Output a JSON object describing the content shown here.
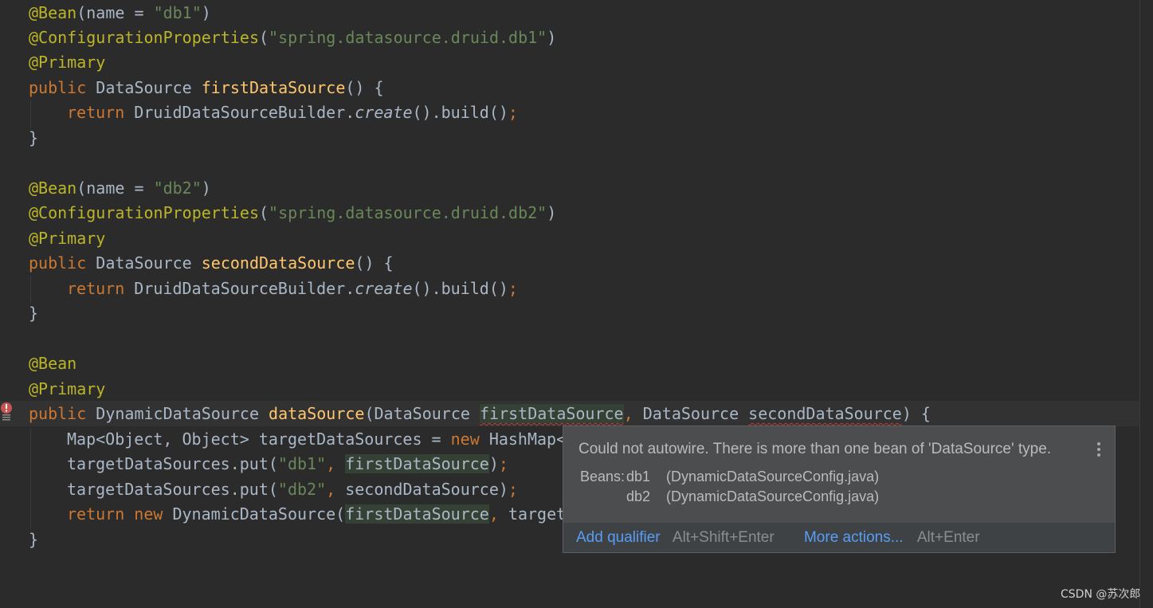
{
  "editor": {
    "bean_annotation": "@Bean",
    "config_props_annotation": "@ConfigurationProperties",
    "primary_annotation": "@Primary",
    "name_param": "name",
    "equals": " = ",
    "kw_public": "public",
    "kw_return": "return",
    "kw_new": "new",
    "type_datasource": "DataSource",
    "type_dynamic": "DynamicDataSource",
    "builder_class": "DruidDataSourceBuilder.",
    "builder_create": "create",
    "builder_tail": "().build()",
    "semicolon": ";",
    "open_paren": "(",
    "close_paren": ")",
    "method_sig_tail": "() {",
    "open_brace": " {",
    "close_brace": "}",
    "comma": ",",
    "bean1_name": "\"db1\"",
    "bean2_name": "\"db2\"",
    "prefix1": "\"spring.datasource.druid.db1\"",
    "prefix2": "\"spring.datasource.druid.db2\"",
    "method1": "firstDataSource",
    "method2": "secondDataSource",
    "method3": "dataSource",
    "param1": "firstDataSource",
    "param2": "secondDataSource",
    "map_decl_head": "Map<Object, Object> targetDataSources = ",
    "hashmap_tail": "HashMap<",
    "put_call": "targetDataSources.put(",
    "db1_key": "\"db1\"",
    "db2_key": "\"db2\"",
    "return_tail": "target"
  },
  "gutter": {
    "error_icon": "error-bulb-icon"
  },
  "popup": {
    "message": "Could not autowire. There is more than one bean of 'DataSource' type.",
    "beans_label": "Beans:",
    "beans": [
      {
        "name": "db1",
        "source": "(DynamicDataSourceConfig.java)"
      },
      {
        "name": "db2",
        "source": "(DynamicDataSourceConfig.java)"
      }
    ],
    "action_primary": "Add qualifier",
    "action_primary_shortcut": "Alt+Shift+Enter",
    "action_more": "More actions...",
    "action_more_shortcut": "Alt+Enter",
    "menu_icon": "more-vertical-icon"
  },
  "watermark": "CSDN @苏次郎",
  "colors": {
    "background": "#2b2b2b",
    "annotation": "#bbb529",
    "keyword": "#cc7832",
    "string": "#6a8759",
    "method": "#ffc66d",
    "link": "#589df6",
    "error": "#bc3f3c"
  }
}
